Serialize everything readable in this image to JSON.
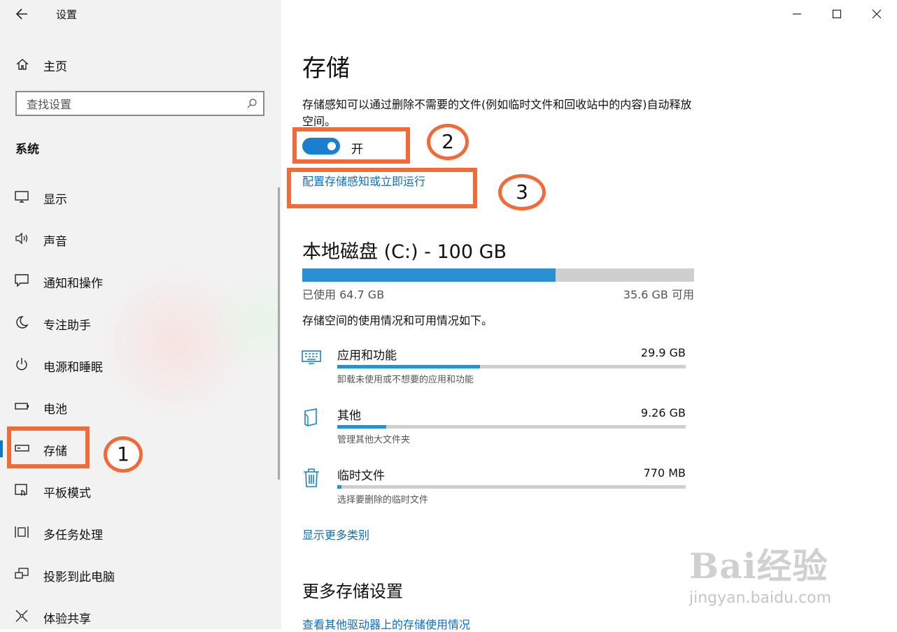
{
  "window": {
    "title": "设置"
  },
  "sidebar": {
    "home_label": "主页",
    "search_placeholder": "查找设置",
    "section": "系统",
    "items": [
      {
        "label": "显示",
        "icon": "monitor-icon"
      },
      {
        "label": "声音",
        "icon": "speaker-icon"
      },
      {
        "label": "通知和操作",
        "icon": "notification-icon"
      },
      {
        "label": "专注助手",
        "icon": "moon-icon"
      },
      {
        "label": "电源和睡眠",
        "icon": "power-icon"
      },
      {
        "label": "电池",
        "icon": "battery-icon"
      },
      {
        "label": "存储",
        "icon": "drive-icon",
        "selected": true
      },
      {
        "label": "平板模式",
        "icon": "tablet-icon"
      },
      {
        "label": "多任务处理",
        "icon": "multitask-icon"
      },
      {
        "label": "投影到此电脑",
        "icon": "project-icon"
      },
      {
        "label": "体验共享",
        "icon": "share-icon"
      }
    ]
  },
  "main": {
    "title": "存储",
    "storage_sense": {
      "description": "存储感知可以通过删除不需要的文件(例如临时文件和回收站中的内容)自动释放空间。",
      "toggle_state": "开",
      "toggle_on": true,
      "configure_link": "配置存储感知或立即运行"
    },
    "disk": {
      "title": "本地磁盘 (C:) - 100 GB",
      "used_label": "已使用 64.7 GB",
      "free_label": "35.6 GB 可用",
      "used_fraction": 0.647,
      "usage_desc": "存储空间的使用情况和可用情况如下。"
    },
    "categories": [
      {
        "name": "应用和功能",
        "size": "29.9 GB",
        "sub": "卸载未使用或不想要的应用和功能",
        "fraction": 0.41,
        "icon": "apps-icon"
      },
      {
        "name": "其他",
        "size": "9.26 GB",
        "sub": "管理其他大文件夹",
        "fraction": 0.14,
        "icon": "folder-icon"
      },
      {
        "name": "临时文件",
        "size": "770 MB",
        "sub": "选择要删除的临时文件",
        "fraction": 0.012,
        "icon": "trash-icon"
      }
    ],
    "show_more_link": "显示更多类别",
    "more_settings_title": "更多存储设置",
    "other_drives_link": "查看其他驱动器上的存储使用情况"
  },
  "annotations": {
    "one": "1",
    "two": "2",
    "three": "3"
  },
  "colors": {
    "accent": "#0a77c8",
    "annotation": "#f06b37"
  },
  "watermark": {
    "logo": "Bai经验",
    "url": "jingyan.baidu.com"
  }
}
